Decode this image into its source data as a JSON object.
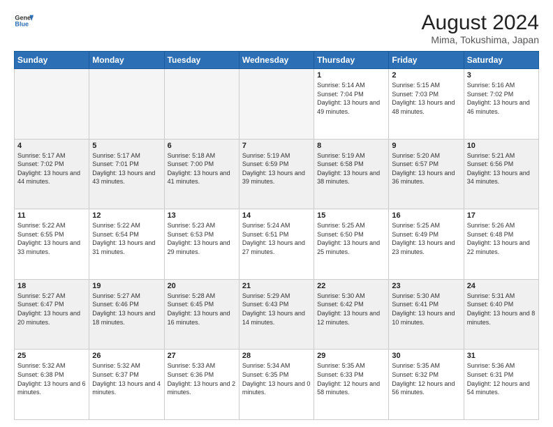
{
  "header": {
    "logo_line1": "General",
    "logo_line2": "Blue",
    "main_title": "August 2024",
    "subtitle": "Mima, Tokushima, Japan"
  },
  "days_of_week": [
    "Sunday",
    "Monday",
    "Tuesday",
    "Wednesday",
    "Thursday",
    "Friday",
    "Saturday"
  ],
  "weeks": [
    [
      {
        "day": "",
        "empty": true
      },
      {
        "day": "",
        "empty": true
      },
      {
        "day": "",
        "empty": true
      },
      {
        "day": "",
        "empty": true
      },
      {
        "day": "1",
        "sunrise": "5:14 AM",
        "sunset": "7:04 PM",
        "daylight": "13 hours and 49 minutes."
      },
      {
        "day": "2",
        "sunrise": "5:15 AM",
        "sunset": "7:03 PM",
        "daylight": "13 hours and 48 minutes."
      },
      {
        "day": "3",
        "sunrise": "5:16 AM",
        "sunset": "7:02 PM",
        "daylight": "13 hours and 46 minutes."
      }
    ],
    [
      {
        "day": "4",
        "sunrise": "5:17 AM",
        "sunset": "7:02 PM",
        "daylight": "13 hours and 44 minutes."
      },
      {
        "day": "5",
        "sunrise": "5:17 AM",
        "sunset": "7:01 PM",
        "daylight": "13 hours and 43 minutes."
      },
      {
        "day": "6",
        "sunrise": "5:18 AM",
        "sunset": "7:00 PM",
        "daylight": "13 hours and 41 minutes."
      },
      {
        "day": "7",
        "sunrise": "5:19 AM",
        "sunset": "6:59 PM",
        "daylight": "13 hours and 39 minutes."
      },
      {
        "day": "8",
        "sunrise": "5:19 AM",
        "sunset": "6:58 PM",
        "daylight": "13 hours and 38 minutes."
      },
      {
        "day": "9",
        "sunrise": "5:20 AM",
        "sunset": "6:57 PM",
        "daylight": "13 hours and 36 minutes."
      },
      {
        "day": "10",
        "sunrise": "5:21 AM",
        "sunset": "6:56 PM",
        "daylight": "13 hours and 34 minutes."
      }
    ],
    [
      {
        "day": "11",
        "sunrise": "5:22 AM",
        "sunset": "6:55 PM",
        "daylight": "13 hours and 33 minutes."
      },
      {
        "day": "12",
        "sunrise": "5:22 AM",
        "sunset": "6:54 PM",
        "daylight": "13 hours and 31 minutes."
      },
      {
        "day": "13",
        "sunrise": "5:23 AM",
        "sunset": "6:53 PM",
        "daylight": "13 hours and 29 minutes."
      },
      {
        "day": "14",
        "sunrise": "5:24 AM",
        "sunset": "6:51 PM",
        "daylight": "13 hours and 27 minutes."
      },
      {
        "day": "15",
        "sunrise": "5:25 AM",
        "sunset": "6:50 PM",
        "daylight": "13 hours and 25 minutes."
      },
      {
        "day": "16",
        "sunrise": "5:25 AM",
        "sunset": "6:49 PM",
        "daylight": "13 hours and 23 minutes."
      },
      {
        "day": "17",
        "sunrise": "5:26 AM",
        "sunset": "6:48 PM",
        "daylight": "13 hours and 22 minutes."
      }
    ],
    [
      {
        "day": "18",
        "sunrise": "5:27 AM",
        "sunset": "6:47 PM",
        "daylight": "13 hours and 20 minutes."
      },
      {
        "day": "19",
        "sunrise": "5:27 AM",
        "sunset": "6:46 PM",
        "daylight": "13 hours and 18 minutes."
      },
      {
        "day": "20",
        "sunrise": "5:28 AM",
        "sunset": "6:45 PM",
        "daylight": "13 hours and 16 minutes."
      },
      {
        "day": "21",
        "sunrise": "5:29 AM",
        "sunset": "6:43 PM",
        "daylight": "13 hours and 14 minutes."
      },
      {
        "day": "22",
        "sunrise": "5:30 AM",
        "sunset": "6:42 PM",
        "daylight": "13 hours and 12 minutes."
      },
      {
        "day": "23",
        "sunrise": "5:30 AM",
        "sunset": "6:41 PM",
        "daylight": "13 hours and 10 minutes."
      },
      {
        "day": "24",
        "sunrise": "5:31 AM",
        "sunset": "6:40 PM",
        "daylight": "13 hours and 8 minutes."
      }
    ],
    [
      {
        "day": "25",
        "sunrise": "5:32 AM",
        "sunset": "6:38 PM",
        "daylight": "13 hours and 6 minutes."
      },
      {
        "day": "26",
        "sunrise": "5:32 AM",
        "sunset": "6:37 PM",
        "daylight": "13 hours and 4 minutes."
      },
      {
        "day": "27",
        "sunrise": "5:33 AM",
        "sunset": "6:36 PM",
        "daylight": "13 hours and 2 minutes."
      },
      {
        "day": "28",
        "sunrise": "5:34 AM",
        "sunset": "6:35 PM",
        "daylight": "13 hours and 0 minutes."
      },
      {
        "day": "29",
        "sunrise": "5:35 AM",
        "sunset": "6:33 PM",
        "daylight": "12 hours and 58 minutes."
      },
      {
        "day": "30",
        "sunrise": "5:35 AM",
        "sunset": "6:32 PM",
        "daylight": "12 hours and 56 minutes."
      },
      {
        "day": "31",
        "sunrise": "5:36 AM",
        "sunset": "6:31 PM",
        "daylight": "12 hours and 54 minutes."
      }
    ]
  ],
  "labels": {
    "sunrise_prefix": "Sunrise:",
    "sunset_prefix": "Sunset:",
    "daylight_prefix": "Daylight:"
  }
}
